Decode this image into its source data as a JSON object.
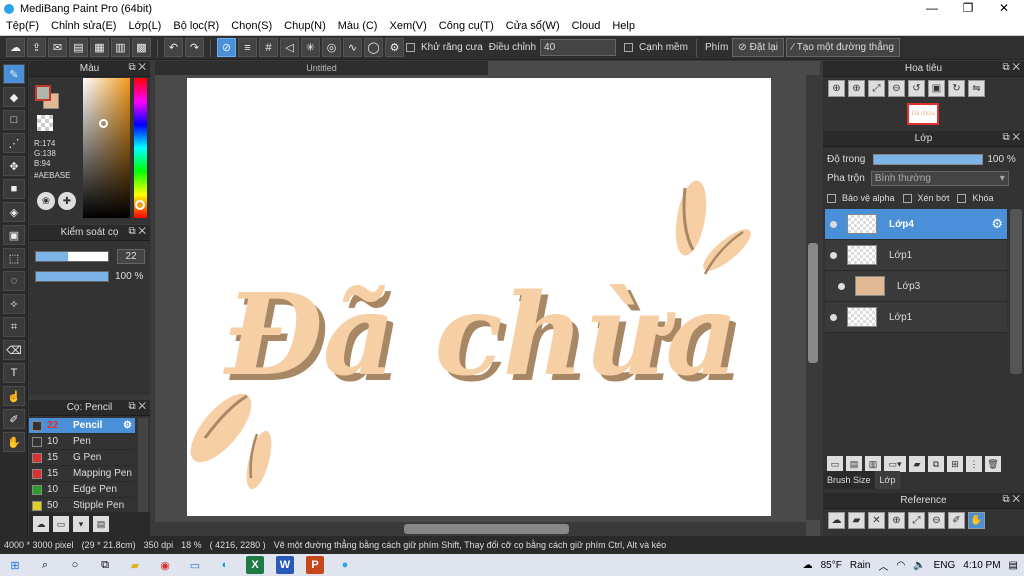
{
  "window": {
    "title": "MediBang Paint Pro (64bit)",
    "min": "—",
    "max": "❐",
    "close": "✕"
  },
  "menu": [
    "Tệp(F)",
    "Chỉnh sửa(E)",
    "Lớp(L)",
    "Bộ lọc(R)",
    "Chọn(S)",
    "Chụp(N)",
    "Màu (C)",
    "Xem(V)",
    "Công cụ(T)",
    "Cửa sổ(W)",
    "Cloud",
    "Help"
  ],
  "toolbar": {
    "antialias_label": "Khử răng cưa",
    "correction_label": "Điều chỉnh",
    "correction_value": "40",
    "edge_label": "Cạnh mềm",
    "key_label": "Phím",
    "reset_label": "Đặt lại",
    "create_line_label": "Tạo một đường thẳng"
  },
  "color_panel": {
    "title": "Màu",
    "r": "R:174",
    "g": "G:138",
    "b": "B:94",
    "hex": "#AEBASE"
  },
  "brush_control": {
    "title": "Kiểm soát cọ",
    "size": "22",
    "opacity": "100 %"
  },
  "brush_list": {
    "title": "Cọ: Pencil",
    "items": [
      {
        "size": "22",
        "name": "Pencil",
        "color": "#333333"
      },
      {
        "size": "10",
        "name": "Pen",
        "color": "#333333"
      },
      {
        "size": "15",
        "name": "G Pen",
        "color": "#d93030"
      },
      {
        "size": "15",
        "name": "Mapping Pen",
        "color": "#d93030"
      },
      {
        "size": "10",
        "name": "Edge Pen",
        "color": "#2aa02a"
      },
      {
        "size": "50",
        "name": "Stipple Pen",
        "color": "#e0d020"
      }
    ]
  },
  "canvas": {
    "tab": "Untitled",
    "text": "Đã chừa"
  },
  "navigator": {
    "title": "Hoa tiêu",
    "thumb": "Đã chừa"
  },
  "layer_panel": {
    "title": "Lớp",
    "opacity_label": "Độ trong",
    "opacity_value": "100 %",
    "blend_label": "Pha trộn",
    "blend_value": "Bình thường",
    "protect_alpha": "Bảo vệ alpha",
    "clipping": "Xén bớt",
    "lock": "Khóa",
    "layers": [
      "Lớp4",
      "Lớp1",
      "Lớp3",
      "Lớp1"
    ]
  },
  "bottom_tabs": [
    "Brush Size",
    "Lớp"
  ],
  "reference": {
    "title": "Reference"
  },
  "status": {
    "size": "4000 * 3000 pixel",
    "cm": "(29 * 21.8cm)",
    "dpi": "350 dpi",
    "zoom": "18 %",
    "coords": "( 4216, 2280 )",
    "hint": "Vẽ một đường thẳng bằng cách giữ phím Shift, Thay đổi cỡ cọ bằng cách giữ phím Ctrl, Alt và kéo"
  },
  "taskbar": {
    "temp": "85°F",
    "weather": "Rain",
    "lang": "ENG",
    "time": "4:10 PM"
  },
  "colors": {
    "accent": "#4a90d9",
    "peach": "#f6cfa4",
    "brown": "#a88765"
  }
}
